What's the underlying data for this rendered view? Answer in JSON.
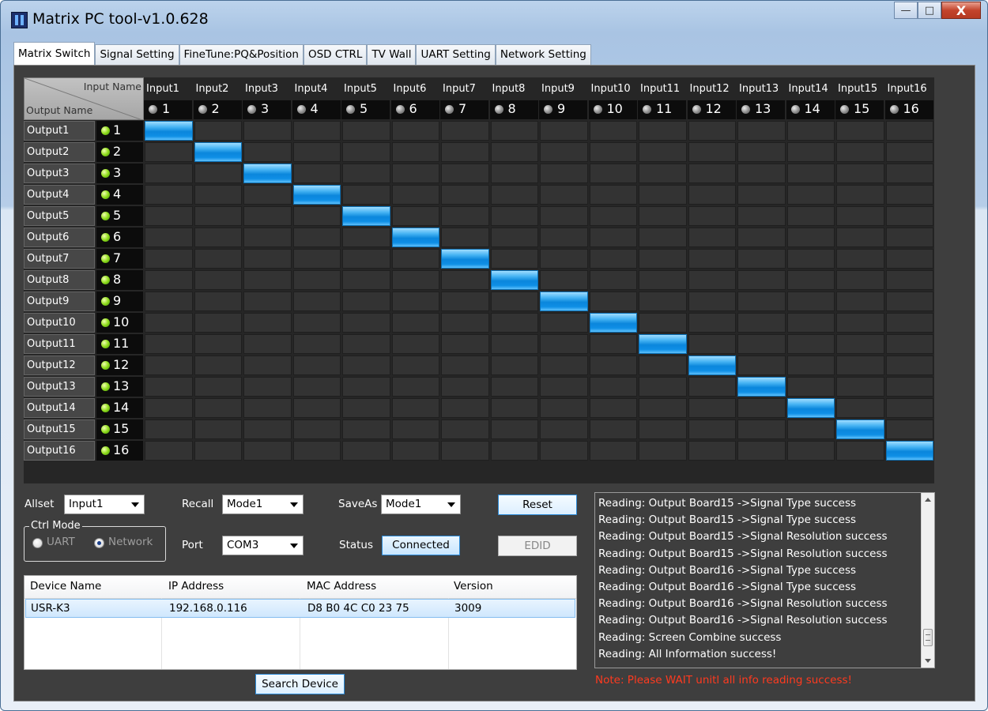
{
  "window": {
    "title": "Matrix PC tool-v1.0.628",
    "minimize": "—",
    "maximize": "□",
    "close": "X"
  },
  "tabs": [
    "Matrix Switch",
    "Signal Setting",
    "FineTune:PQ&Position",
    "OSD CTRL",
    "TV Wall",
    "UART Setting",
    "Network Setting"
  ],
  "active_tab": "Matrix Switch",
  "matrix": {
    "corner_input": "Input Name",
    "corner_output": "Output Name",
    "inputs": [
      {
        "name": "Input1",
        "num": "1"
      },
      {
        "name": "Input2",
        "num": "2"
      },
      {
        "name": "Input3",
        "num": "3"
      },
      {
        "name": "Input4",
        "num": "4"
      },
      {
        "name": "Input5",
        "num": "5"
      },
      {
        "name": "Input6",
        "num": "6"
      },
      {
        "name": "Input7",
        "num": "7"
      },
      {
        "name": "Input8",
        "num": "8"
      },
      {
        "name": "Input9",
        "num": "9"
      },
      {
        "name": "Input10",
        "num": "10"
      },
      {
        "name": "Input11",
        "num": "11"
      },
      {
        "name": "Input12",
        "num": "12"
      },
      {
        "name": "Input13",
        "num": "13"
      },
      {
        "name": "Input14",
        "num": "14"
      },
      {
        "name": "Input15",
        "num": "15"
      },
      {
        "name": "Input16",
        "num": "16"
      }
    ],
    "outputs": [
      {
        "name": "Output1",
        "num": "1",
        "routed_input": 1
      },
      {
        "name": "Output2",
        "num": "2",
        "routed_input": 2
      },
      {
        "name": "Output3",
        "num": "3",
        "routed_input": 3
      },
      {
        "name": "Output4",
        "num": "4",
        "routed_input": 4
      },
      {
        "name": "Output5",
        "num": "5",
        "routed_input": 5
      },
      {
        "name": "Output6",
        "num": "6",
        "routed_input": 6
      },
      {
        "name": "Output7",
        "num": "7",
        "routed_input": 7
      },
      {
        "name": "Output8",
        "num": "8",
        "routed_input": 8
      },
      {
        "name": "Output9",
        "num": "9",
        "routed_input": 9
      },
      {
        "name": "Output10",
        "num": "10",
        "routed_input": 10
      },
      {
        "name": "Output11",
        "num": "11",
        "routed_input": 11
      },
      {
        "name": "Output12",
        "num": "12",
        "routed_input": 12
      },
      {
        "name": "Output13",
        "num": "13",
        "routed_input": 13
      },
      {
        "name": "Output14",
        "num": "14",
        "routed_input": 14
      },
      {
        "name": "Output15",
        "num": "15",
        "routed_input": 15
      },
      {
        "name": "Output16",
        "num": "16",
        "routed_input": 16
      }
    ],
    "input_led_color": "grey",
    "output_led_color": "green",
    "active_cell_color": "#1c9ae8"
  },
  "controls": {
    "allset_label": "Allset",
    "allset_value": "Input1",
    "recall_label": "Recall",
    "recall_value": "Mode1",
    "saveas_label": "SaveAs",
    "saveas_value": "Mode1",
    "reset_label": "Reset",
    "ctrl_mode_label": "Ctrl Mode",
    "uart_label": "UART",
    "network_label": "Network",
    "selected_mode": "Network",
    "port_label": "Port",
    "port_value": "COM3",
    "status_label": "Status",
    "status_value": "Connected",
    "edid_label": "EDID"
  },
  "devices": {
    "columns": [
      "Device Name",
      "IP Address",
      "MAC Address",
      "Version"
    ],
    "rows": [
      [
        "USR-K3",
        "192.168.0.116",
        "D8 B0 4C C0 23 75",
        "3009"
      ]
    ]
  },
  "search_button": "Search Device",
  "log": [
    "Reading: Output Board15 ->Signal Type success",
    "Reading: Output Board15 ->Signal Type success",
    "Reading: Output Board15 ->Signal Resolution success",
    "Reading: Output Board15 ->Signal Resolution success",
    "Reading: Output Board16 ->Signal Type success",
    "Reading: Output Board16 ->Signal Type success",
    "Reading: Output Board16 ->Signal Resolution success",
    "Reading: Output Board16 ->Signal Resolution success",
    "Reading: Screen Combine success",
    "Reading: All Information success!"
  ],
  "note": "Note: Please WAIT unitl all info reading success!"
}
